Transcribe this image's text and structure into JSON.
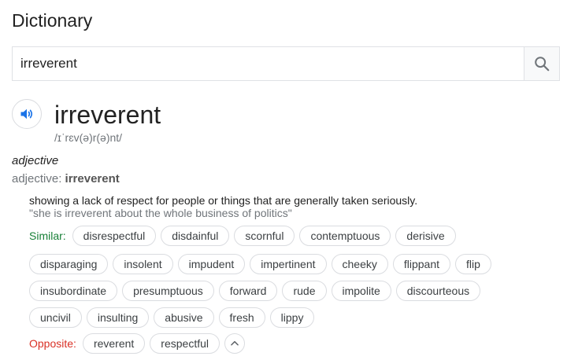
{
  "page_title": "Dictionary",
  "search": {
    "value": "irreverent",
    "button_icon": "search-icon"
  },
  "entry": {
    "word": "irreverent",
    "phonetic": "/ɪˈrɛv(ə)r(ə)nt/",
    "pronounce_icon": "speaker-icon",
    "part_of_speech": "adjective",
    "pos_label": "adjective:",
    "pos_word": "irreverent",
    "definition": "showing a lack of respect for people or things that are generally taken seriously.",
    "example": "\"she is irreverent about the whole business of politics\""
  },
  "similar": {
    "label": "Similar:",
    "rows": [
      [
        "disrespectful",
        "disdainful",
        "scornful",
        "contemptuous",
        "derisive"
      ],
      [
        "disparaging",
        "insolent",
        "impudent",
        "impertinent",
        "cheeky",
        "flippant",
        "flip"
      ],
      [
        "insubordinate",
        "presumptuous",
        "forward",
        "rude",
        "impolite",
        "discourteous"
      ],
      [
        "uncivil",
        "insulting",
        "abusive",
        "fresh",
        "lippy"
      ]
    ]
  },
  "opposite": {
    "label": "Opposite:",
    "words": [
      "reverent",
      "respectful"
    ],
    "collapse_icon": "chevron-up-icon"
  },
  "colors": {
    "similar_label": "#188038",
    "opposite_label": "#d93025",
    "accent": "#1a73e8"
  }
}
